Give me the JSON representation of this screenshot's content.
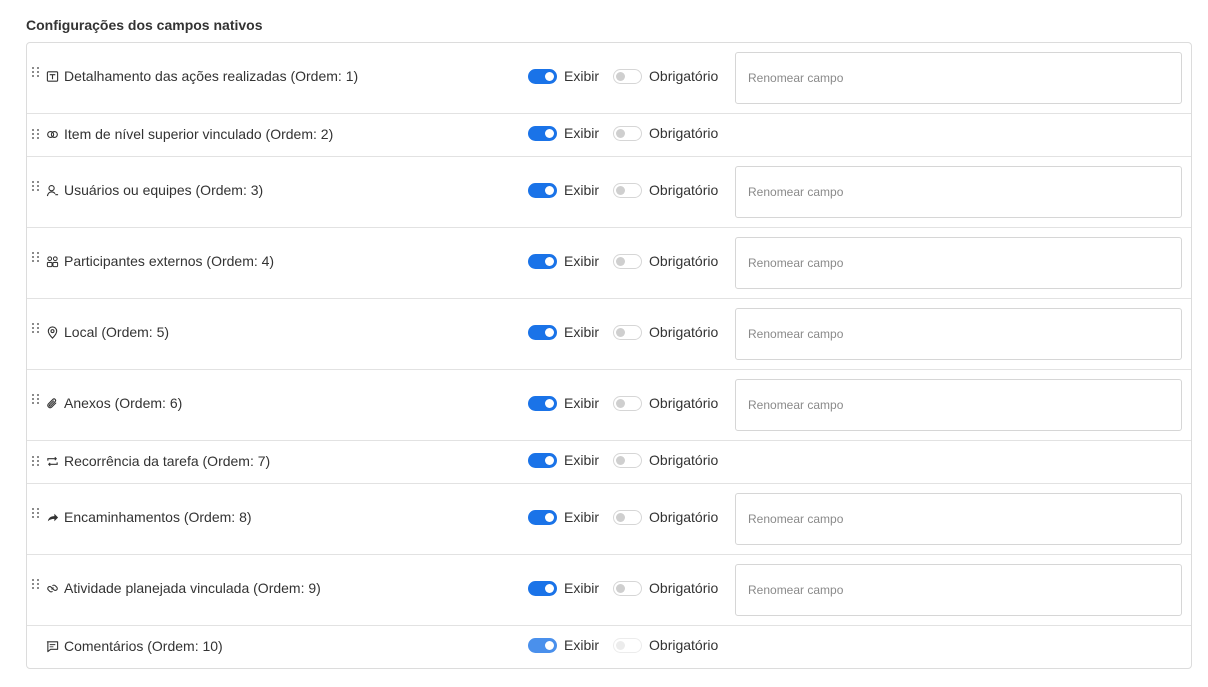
{
  "section_title": "Configurações dos campos nativos",
  "labels": {
    "show": "Exibir",
    "required": "Obrigatório"
  },
  "rename_placeholder": "Renomear campo",
  "colors": {
    "toggle_on": "#1a73e8",
    "border": "#dcdcdc"
  },
  "fields": [
    {
      "label": "Detalhamento das ações realizadas (Ordem: 1)",
      "icon": "text-box-icon",
      "show": true,
      "required": false,
      "rename": true
    },
    {
      "label": "Item de nível superior vinculado (Ordem: 2)",
      "icon": "link-chain-icon",
      "show": true,
      "required": false,
      "rename": false
    },
    {
      "label": "Usuários ou equipes (Ordem: 3)",
      "icon": "user-icon",
      "show": true,
      "required": false,
      "rename": true
    },
    {
      "label": "Participantes externos (Ordem: 4)",
      "icon": "group-icon",
      "show": true,
      "required": false,
      "rename": true
    },
    {
      "label": "Local (Ordem: 5)",
      "icon": "location-pin-icon",
      "show": true,
      "required": false,
      "rename": true
    },
    {
      "label": "Anexos (Ordem: 6)",
      "icon": "paperclip-icon",
      "show": true,
      "required": false,
      "rename": true
    },
    {
      "label": "Recorrência da tarefa (Ordem: 7)",
      "icon": "repeat-icon",
      "show": true,
      "required": false,
      "rename": false
    },
    {
      "label": "Encaminhamentos (Ordem: 8)",
      "icon": "forward-arrow-icon",
      "show": true,
      "required": false,
      "rename": true
    },
    {
      "label": "Atividade planejada vinculada (Ordem: 9)",
      "icon": "link-icon",
      "show": true,
      "required": false,
      "rename": true
    },
    {
      "label": "Comentários (Ordem: 10)",
      "icon": "comment-icon",
      "show": true,
      "required": false,
      "rename": false,
      "disabled": true
    }
  ]
}
